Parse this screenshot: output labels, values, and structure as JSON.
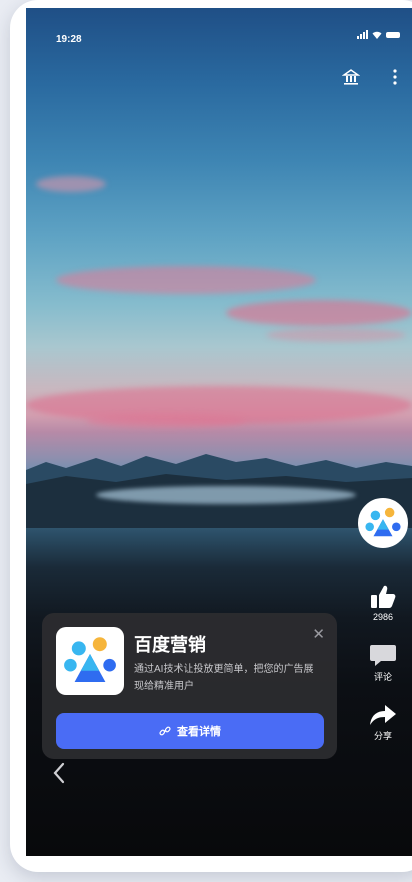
{
  "status_bar": {
    "time": "19:28"
  },
  "top_actions": {
    "icons": [
      "bank-icon",
      "more-vertical-icon"
    ]
  },
  "side_rail": {
    "avatar_icon": "baidu-marketing-logo",
    "like": {
      "icon": "thumb-up-icon",
      "count": "2986"
    },
    "comment": {
      "icon": "comment-icon",
      "label": "评论"
    },
    "share": {
      "icon": "share-arrow-icon",
      "label": "分享"
    }
  },
  "ad_card": {
    "title": "百度营销",
    "description": "通过AI技术让投放更简单，把您的广告展现给精准用户",
    "close_icon": "close-icon",
    "cta_label": "查看详情",
    "cta_icon": "link-icon"
  },
  "nav": {
    "back_icon": "chevron-left-icon"
  },
  "colors": {
    "cta": "#4a6cf5",
    "card_bg": "#2d2d30",
    "logo_blue": "#2f6cf0",
    "logo_light_blue": "#38b6f0",
    "logo_yellow": "#f6b53b"
  }
}
